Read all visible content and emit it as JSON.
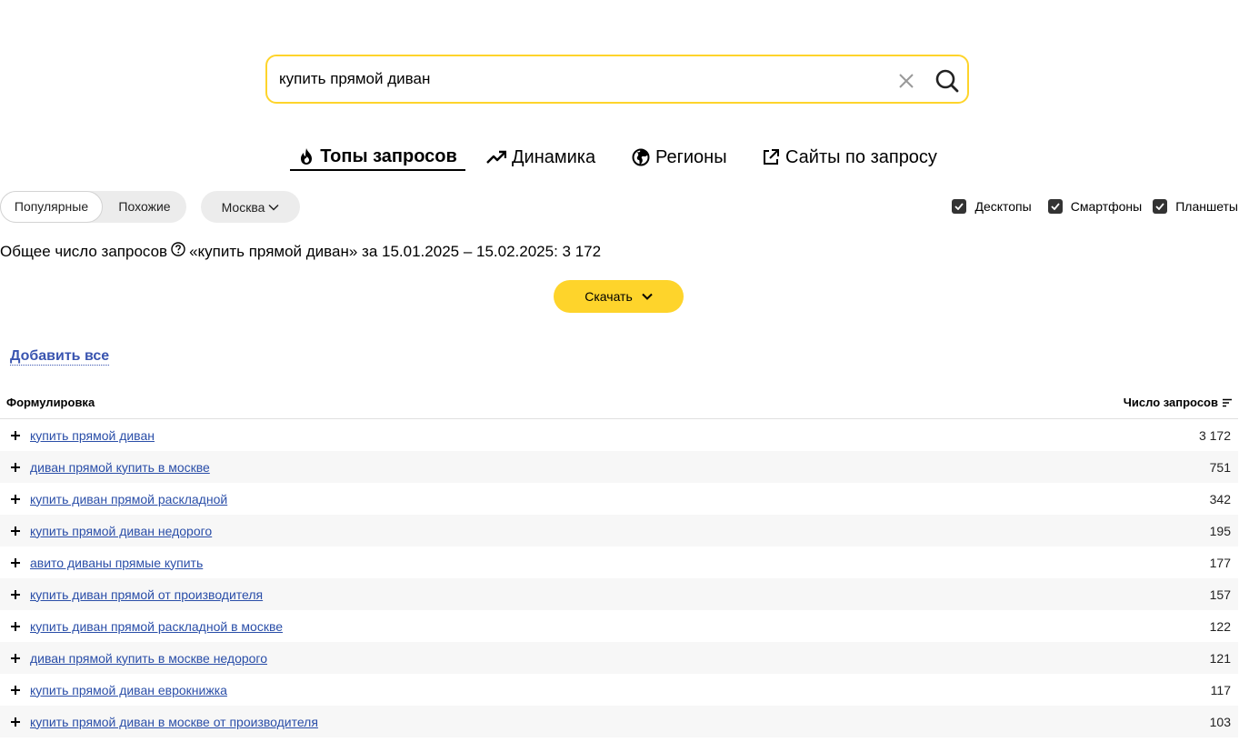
{
  "search": {
    "query": "купить прямой диван",
    "clear_icon": "close-icon",
    "search_icon": "search-icon"
  },
  "tabs": [
    {
      "label": "Топы запросов",
      "icon": "fire-icon",
      "active": true
    },
    {
      "label": "Динамика",
      "icon": "trend-up-icon",
      "active": false
    },
    {
      "label": "Регионы",
      "icon": "globe-icon",
      "active": false
    },
    {
      "label": "Сайты по запросу",
      "icon": "external-link-icon",
      "active": false
    }
  ],
  "filters": {
    "mode": {
      "popular": "Популярные",
      "similar": "Похожие",
      "selected": "Популярные"
    },
    "region": "Москва",
    "devices": [
      {
        "label": "Десктопы",
        "checked": true
      },
      {
        "label": "Смартфоны",
        "checked": true
      },
      {
        "label": "Планшеты",
        "checked": true
      }
    ]
  },
  "summary": {
    "prefix": "Общее число запросов",
    "text": "«купить прямой диван» за 15.01.2025 – 15.02.2025: 3 172"
  },
  "download_label": "Скачать",
  "add_all_label": "Добавить все",
  "table": {
    "col_phrase": "Формулировка",
    "col_count": "Число запросов",
    "rows": [
      {
        "phrase": "купить прямой диван",
        "count": "3 172"
      },
      {
        "phrase": "диван прямой купить в москве",
        "count": "751"
      },
      {
        "phrase": "купить диван прямой раскладной",
        "count": "342"
      },
      {
        "phrase": "купить прямой диван недорого",
        "count": "195"
      },
      {
        "phrase": "авито диваны прямые купить",
        "count": "177"
      },
      {
        "phrase": "купить диван прямой от производителя",
        "count": "157"
      },
      {
        "phrase": "купить диван прямой раскладной в москве",
        "count": "122"
      },
      {
        "phrase": "диван прямой купить в москве недорого",
        "count": "121"
      },
      {
        "phrase": "купить прямой диван еврокнижка",
        "count": "117"
      },
      {
        "phrase": "купить прямой диван в москве от производителя",
        "count": "103"
      }
    ]
  },
  "colors": {
    "accent_yellow": "#fed42b",
    "link_blue": "#2a4ea8",
    "row_stripe": "#f7f7f7"
  }
}
